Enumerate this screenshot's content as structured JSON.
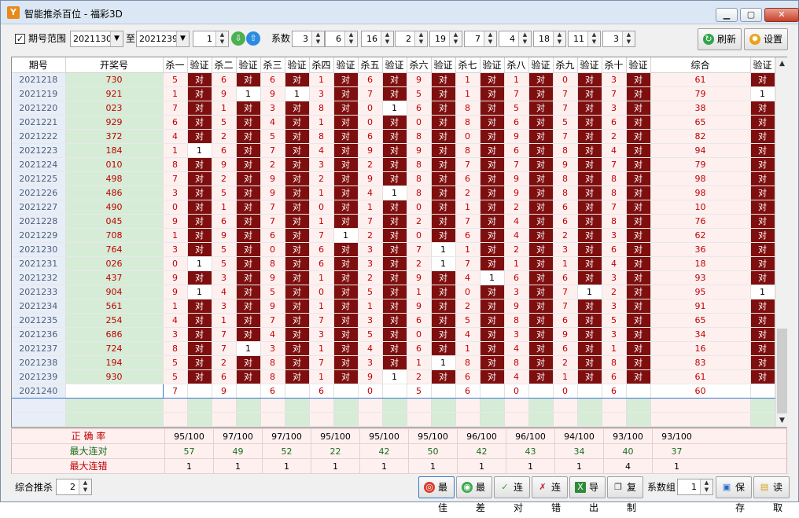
{
  "window": {
    "title": "智能推杀百位 - 福彩3D",
    "icon_glyph": "Y"
  },
  "controls": {
    "check_mark": "✓",
    "range_label": "期号范围",
    "range_from": "2021130",
    "to_label": "至",
    "range_to": "2021239",
    "spin1": "1",
    "coef_label": "系数",
    "coefs": [
      "3",
      "6",
      "16",
      "2",
      "19",
      "7",
      "4",
      "18",
      "11",
      "3"
    ],
    "refresh": "刷新",
    "settings": "设置"
  },
  "columns": [
    "期号",
    "开奖号",
    "杀一",
    "验证",
    "杀二",
    "验证",
    "杀三",
    "验证",
    "杀四",
    "验证",
    "杀五",
    "验证",
    "杀六",
    "验证",
    "杀七",
    "验证",
    "杀八",
    "验证",
    "杀九",
    "验证",
    "杀十",
    "验证",
    "综合",
    "验证"
  ],
  "verify_ok": "对",
  "rows": [
    [
      "2021218",
      "730",
      5,
      0,
      6,
      0,
      6,
      0,
      1,
      0,
      6,
      0,
      9,
      0,
      1,
      0,
      1,
      0,
      0,
      0,
      3,
      0,
      61,
      0
    ],
    [
      "2021219",
      "921",
      1,
      0,
      9,
      1,
      9,
      1,
      3,
      0,
      7,
      0,
      5,
      0,
      1,
      0,
      7,
      0,
      7,
      0,
      7,
      0,
      79,
      1
    ],
    [
      "2021220",
      "023",
      7,
      0,
      1,
      0,
      3,
      0,
      8,
      0,
      0,
      1,
      6,
      0,
      8,
      0,
      5,
      0,
      7,
      0,
      3,
      0,
      38,
      0
    ],
    [
      "2021221",
      "929",
      6,
      0,
      5,
      0,
      4,
      0,
      1,
      0,
      0,
      0,
      0,
      0,
      8,
      0,
      6,
      0,
      5,
      0,
      6,
      0,
      65,
      0
    ],
    [
      "2021222",
      "372",
      4,
      0,
      2,
      0,
      5,
      0,
      8,
      0,
      6,
      0,
      8,
      0,
      0,
      0,
      9,
      0,
      7,
      0,
      2,
      0,
      82,
      0
    ],
    [
      "2021223",
      "184",
      1,
      1,
      6,
      0,
      7,
      0,
      4,
      0,
      9,
      0,
      9,
      0,
      8,
      0,
      6,
      0,
      8,
      0,
      4,
      0,
      94,
      0
    ],
    [
      "2021224",
      "010",
      8,
      0,
      9,
      0,
      2,
      0,
      3,
      0,
      2,
      0,
      8,
      0,
      7,
      0,
      7,
      0,
      9,
      0,
      7,
      0,
      79,
      0
    ],
    [
      "2021225",
      "498",
      7,
      0,
      2,
      0,
      9,
      0,
      2,
      0,
      9,
      0,
      8,
      0,
      6,
      0,
      9,
      0,
      8,
      0,
      8,
      0,
      98,
      0
    ],
    [
      "2021226",
      "486",
      3,
      0,
      5,
      0,
      9,
      0,
      1,
      0,
      4,
      1,
      8,
      0,
      2,
      0,
      9,
      0,
      8,
      0,
      8,
      0,
      98,
      0
    ],
    [
      "2021227",
      "490",
      0,
      0,
      1,
      0,
      7,
      0,
      0,
      0,
      1,
      0,
      0,
      0,
      1,
      0,
      2,
      0,
      6,
      0,
      7,
      0,
      10,
      0
    ],
    [
      "2021228",
      "045",
      9,
      0,
      6,
      0,
      7,
      0,
      1,
      0,
      7,
      0,
      2,
      0,
      7,
      0,
      4,
      0,
      6,
      0,
      8,
      0,
      76,
      0
    ],
    [
      "2021229",
      "708",
      1,
      0,
      9,
      0,
      6,
      0,
      7,
      1,
      2,
      0,
      0,
      0,
      6,
      0,
      4,
      0,
      2,
      0,
      3,
      0,
      62,
      0
    ],
    [
      "2021230",
      "764",
      3,
      0,
      5,
      0,
      0,
      0,
      6,
      0,
      3,
      0,
      7,
      1,
      1,
      0,
      2,
      0,
      3,
      0,
      6,
      0,
      36,
      0
    ],
    [
      "2021231",
      "026",
      0,
      1,
      5,
      0,
      8,
      0,
      6,
      0,
      3,
      0,
      2,
      1,
      7,
      0,
      1,
      0,
      1,
      0,
      4,
      0,
      18,
      0
    ],
    [
      "2021232",
      "437",
      9,
      0,
      3,
      0,
      9,
      0,
      1,
      0,
      2,
      0,
      9,
      0,
      4,
      1,
      6,
      0,
      6,
      0,
      3,
      0,
      93,
      0
    ],
    [
      "2021233",
      "904",
      9,
      1,
      4,
      0,
      5,
      0,
      0,
      0,
      5,
      0,
      1,
      0,
      0,
      0,
      3,
      0,
      7,
      1,
      2,
      0,
      95,
      1
    ],
    [
      "2021234",
      "561",
      1,
      0,
      3,
      0,
      9,
      0,
      1,
      0,
      1,
      0,
      9,
      0,
      2,
      0,
      9,
      0,
      7,
      0,
      3,
      0,
      91,
      0
    ],
    [
      "2021235",
      "254",
      4,
      0,
      1,
      0,
      7,
      0,
      7,
      0,
      3,
      0,
      6,
      0,
      5,
      0,
      8,
      0,
      6,
      0,
      5,
      0,
      65,
      0
    ],
    [
      "2021236",
      "686",
      3,
      0,
      7,
      0,
      4,
      0,
      3,
      0,
      5,
      0,
      0,
      0,
      4,
      0,
      3,
      0,
      9,
      0,
      3,
      0,
      34,
      0
    ],
    [
      "2021237",
      "724",
      8,
      0,
      7,
      1,
      3,
      0,
      1,
      0,
      4,
      0,
      6,
      0,
      1,
      0,
      4,
      0,
      6,
      0,
      1,
      0,
      16,
      0
    ],
    [
      "2021238",
      "194",
      5,
      0,
      2,
      0,
      8,
      0,
      7,
      0,
      3,
      0,
      1,
      1,
      8,
      0,
      8,
      0,
      2,
      0,
      8,
      0,
      83,
      0
    ],
    [
      "2021239",
      "930",
      5,
      0,
      6,
      0,
      8,
      0,
      1,
      0,
      9,
      1,
      2,
      0,
      6,
      0,
      4,
      0,
      1,
      0,
      6,
      0,
      61,
      0
    ]
  ],
  "current_row": {
    "issue": "2021240",
    "kills": [
      "7",
      "9",
      "6",
      "6",
      "0",
      "5",
      "6",
      "0",
      "0",
      "6"
    ],
    "total": "60"
  },
  "stats": {
    "accuracy_label": "正 确 率",
    "accuracy": [
      "95/100",
      "97/100",
      "97/100",
      "95/100",
      "95/100",
      "95/100",
      "96/100",
      "96/100",
      "94/100",
      "93/100",
      "93/100"
    ],
    "max_ok_label": "最大连对",
    "max_ok": [
      "57",
      "49",
      "52",
      "22",
      "42",
      "50",
      "42",
      "43",
      "34",
      "40",
      "37"
    ],
    "max_err_label": "最大连错",
    "max_err": [
      "1",
      "1",
      "1",
      "1",
      "1",
      "1",
      "1",
      "1",
      "1",
      "4",
      "1"
    ]
  },
  "bottom": {
    "combined_label": "综合推杀",
    "combined_value": "2",
    "best": "最佳",
    "worst": "最差",
    "streak_ok": "连对",
    "streak_err": "连错",
    "export": "导出",
    "copy": "复制",
    "group_label": "系数组",
    "group_value": "1",
    "save": "保存",
    "load": "读取"
  },
  "colors": {
    "ok_bg": "#7f0f0f",
    "red_text": "#c00000",
    "green_text": "#1a6e1a"
  }
}
